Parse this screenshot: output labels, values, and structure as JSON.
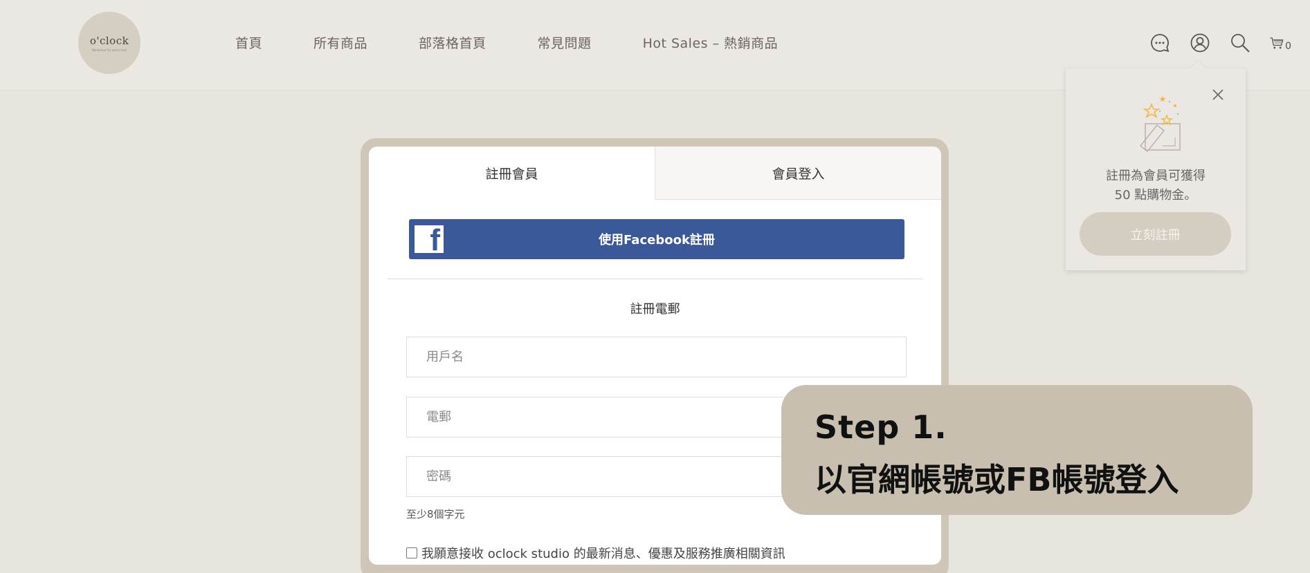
{
  "header": {
    "logo_text": "o'clock",
    "logo_sub": "Bonamour for every kind",
    "nav": [
      "首頁",
      "所有商品",
      "部落格首頁",
      "常見問題",
      "Hot Sales – 熱銷商品"
    ],
    "icons": [
      "chat-icon",
      "user-icon",
      "search-icon",
      "cart-icon"
    ],
    "cart_count": "0"
  },
  "popup": {
    "line1": "註冊為會員可獲得",
    "line2": "50 點購物金。",
    "button": "立刻註冊"
  },
  "form": {
    "tabs": [
      "註冊會員",
      "會員登入"
    ],
    "facebook_button": "使用Facebook註冊",
    "section_title": "註冊電郵",
    "username_placeholder": "用戶名",
    "email_placeholder": "電郵",
    "password_placeholder": "密碼",
    "password_hint": "至少8個字元",
    "newsletter_label": "我願意接收 oclock studio 的最新消息、優惠及服務推廣相關資訊"
  },
  "step": {
    "line1": "Step  1.",
    "line2": "以官網帳號或FB帳號登入"
  },
  "colors": {
    "background": "#e8e5df",
    "facebook": "#3b5998",
    "card_frame": "#cfc6b8",
    "step_bg": "#c9bfb0"
  }
}
